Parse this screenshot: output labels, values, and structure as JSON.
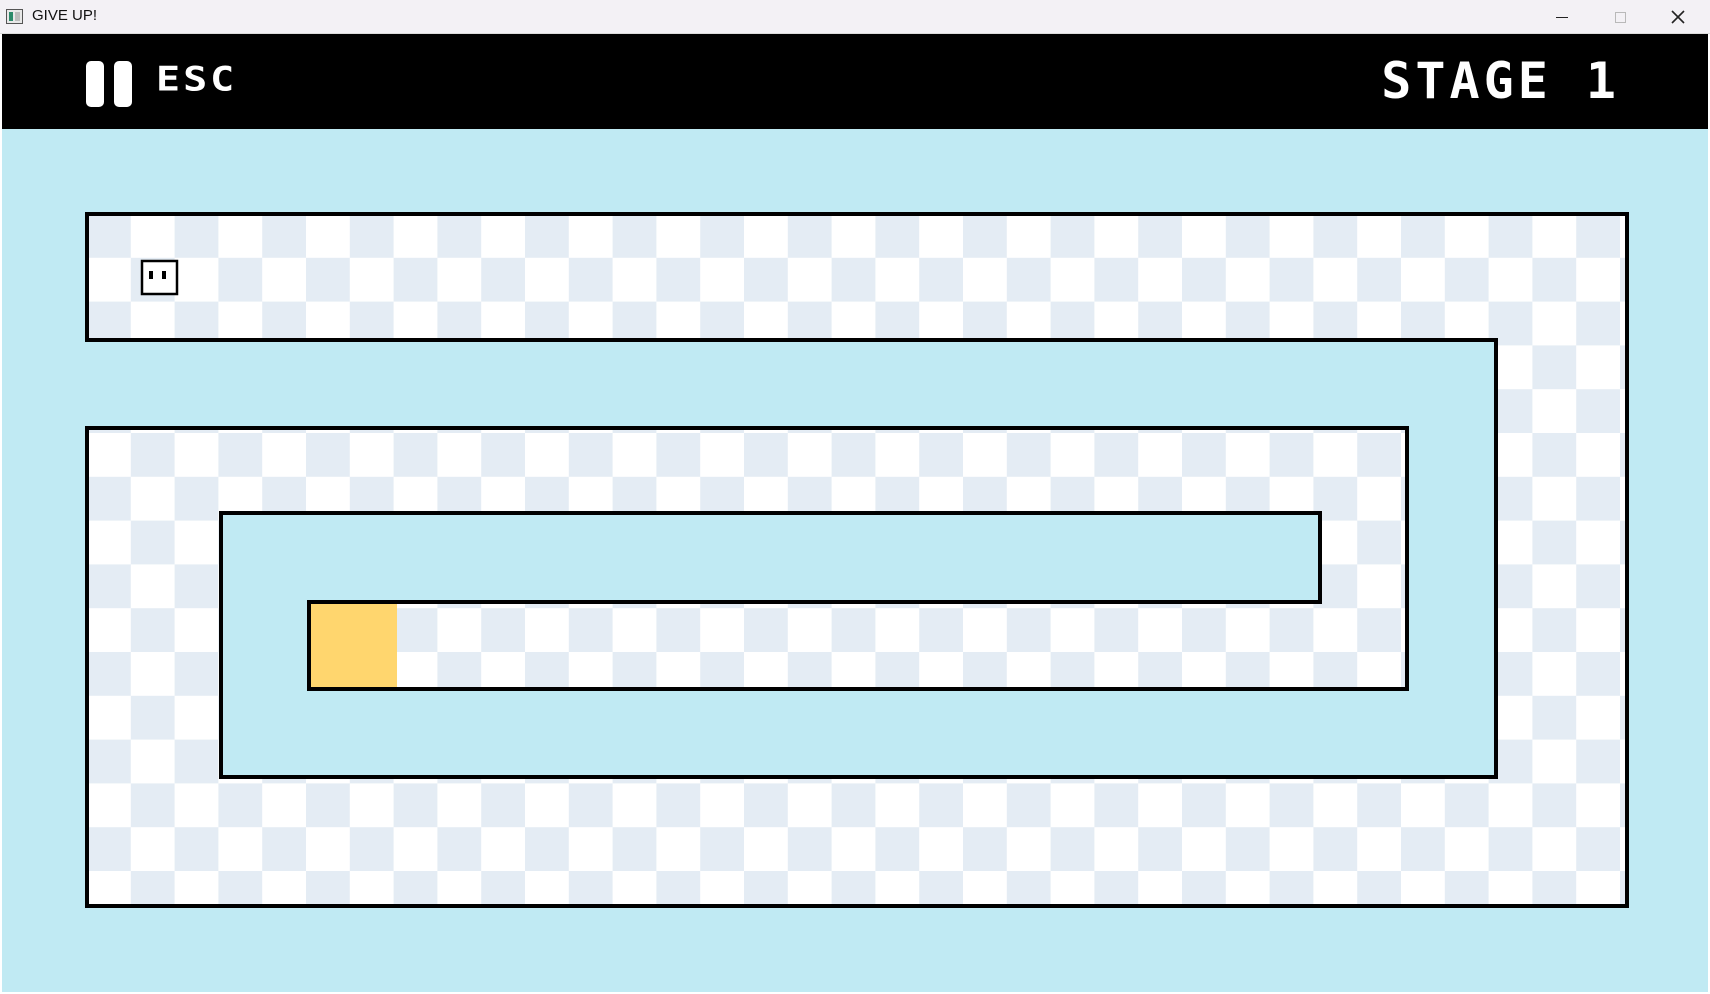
{
  "window": {
    "title": "GIVE UP!",
    "controls": [
      "minimize",
      "maximize",
      "close"
    ]
  },
  "hud": {
    "pause_icon": "pause-icon",
    "pause_key_label": "ESC",
    "stage_label": "STAGE 1"
  },
  "colors": {
    "background": "#c0eaf3",
    "hud_bar": "#000000",
    "track_light": "#ffffff",
    "track_dark": "#e4ecf4",
    "wall": "#000000",
    "goal": "#ffd66e"
  },
  "level": {
    "stage": 1,
    "grid_columns": 35,
    "grid_rows": 16,
    "player": {
      "col": 1,
      "row": 1
    },
    "goal": {
      "col": 5,
      "row": 10
    }
  }
}
